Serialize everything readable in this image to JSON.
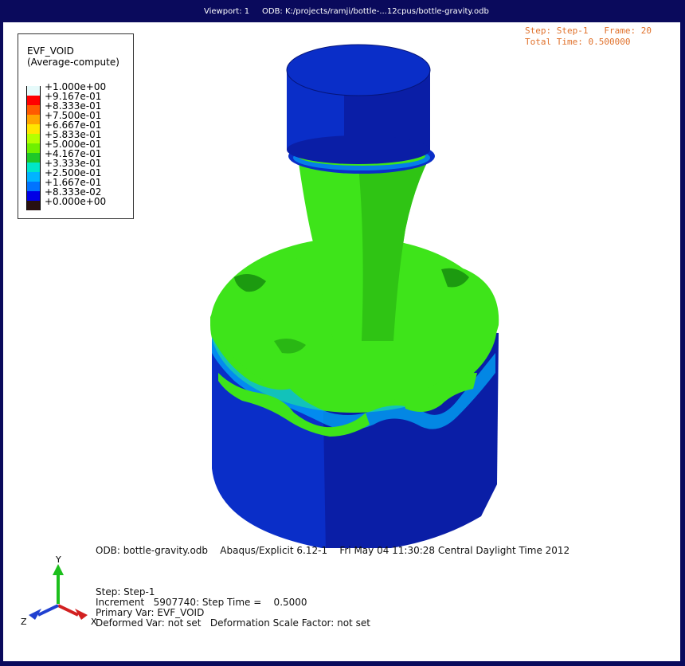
{
  "titlebar": {
    "viewport": "Viewport: 1",
    "odb": "ODB: K:/projects/ramji/bottle-...12cpus/bottle-gravity.odb"
  },
  "legend": {
    "title_line1": "EVF_VOID",
    "title_line2": "(Average-compute)",
    "entries": [
      {
        "label": "+1.000e+00",
        "color": "#e6fafa"
      },
      {
        "label": "+9.167e-01",
        "color": "#ff0000"
      },
      {
        "label": "+8.333e-01",
        "color": "#ff5a00"
      },
      {
        "label": "+7.500e-01",
        "color": "#ffa500"
      },
      {
        "label": "+6.667e-01",
        "color": "#ffe600"
      },
      {
        "label": "+5.833e-01",
        "color": "#b4ff00"
      },
      {
        "label": "+5.000e-01",
        "color": "#6ef000"
      },
      {
        "label": "+4.167e-01",
        "color": "#1ec828"
      },
      {
        "label": "+3.333e-01",
        "color": "#00e6c8"
      },
      {
        "label": "+2.500e-01",
        "color": "#00b4ff"
      },
      {
        "label": "+1.667e-01",
        "color": "#0073ff"
      },
      {
        "label": "+8.333e-02",
        "color": "#0000e6"
      },
      {
        "label": "+0.000e+00",
        "color": "#281010"
      }
    ]
  },
  "step_info": {
    "line1": "Step: Step-1   Frame: 20",
    "line2": "Total Time: 0.500000"
  },
  "footer": {
    "odb_line": "ODB: bottle-gravity.odb    Abaqus/Explicit 6.12-1    Fri May 04 11:30:28 Central Daylight Time 2012",
    "step": "Step: Step-1",
    "increment": "Increment   5907740: Step Time =    0.5000",
    "primary_var": "Primary Var: EVF_VOID",
    "deformed_var": "Deformed Var: not set   Deformation Scale Factor: not set"
  },
  "triad": {
    "y": "Y",
    "z": "Z",
    "x": "X"
  },
  "colors": {
    "background": "#0a0a5c",
    "void_blue": "#0a2ec8",
    "void_blue_dark": "#0a1ea6",
    "fluid_green": "#3ee41a",
    "fluid_green_dark": "#1c9a10",
    "step_text": "#e0712b"
  }
}
